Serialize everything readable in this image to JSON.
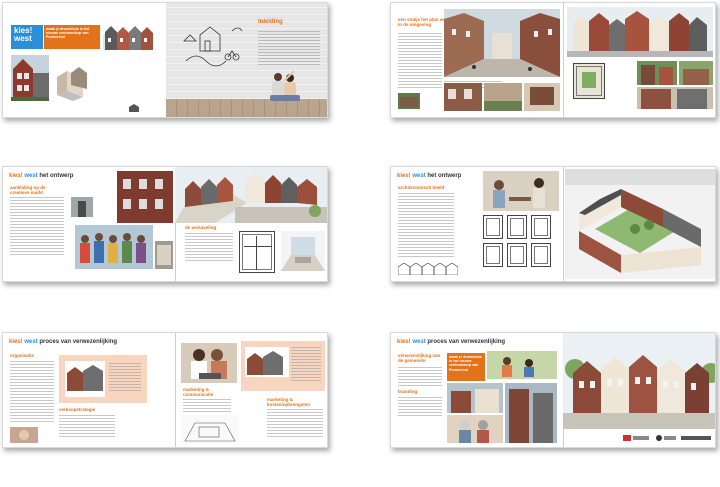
{
  "brand": {
    "kies": "kies!",
    "west": "west"
  },
  "spread1": {
    "logo_line1": "kies!",
    "logo_line2": "west",
    "tagline": "maak je droomhuis in het nieuwe centrumdorp van Purmerend",
    "intro_title": "Inleiding"
  },
  "spread2": {
    "title": "kies!west",
    "heading": "een stukje het plan wel in de omgeving"
  },
  "spread3": {
    "section": "het ontwerp",
    "heading1": "aanleiding op de creatieve markt",
    "heading2": "de verkaveling"
  },
  "spread4": {
    "section": "het ontwerp",
    "heading": "architectonisch beeld"
  },
  "spread5": {
    "section": "proces van verwezenlijking",
    "heading1": "organisatie",
    "heading2": "verkoopstrategie",
    "heading3": "marketing & communicatie",
    "heading4": "marketing & kosten/opbrengsten"
  },
  "spread6": {
    "section": "proces van verwezenlijking",
    "heading1": "verwezenlijking van de gemeente",
    "heading2": "branding",
    "orange_text": "maak je droomhuis in het nieuwe centrumdorp van Purmerend"
  },
  "colors": {
    "orange": "#e2731b",
    "blue": "#2a8fd6",
    "peach": "#f7d5bf"
  }
}
